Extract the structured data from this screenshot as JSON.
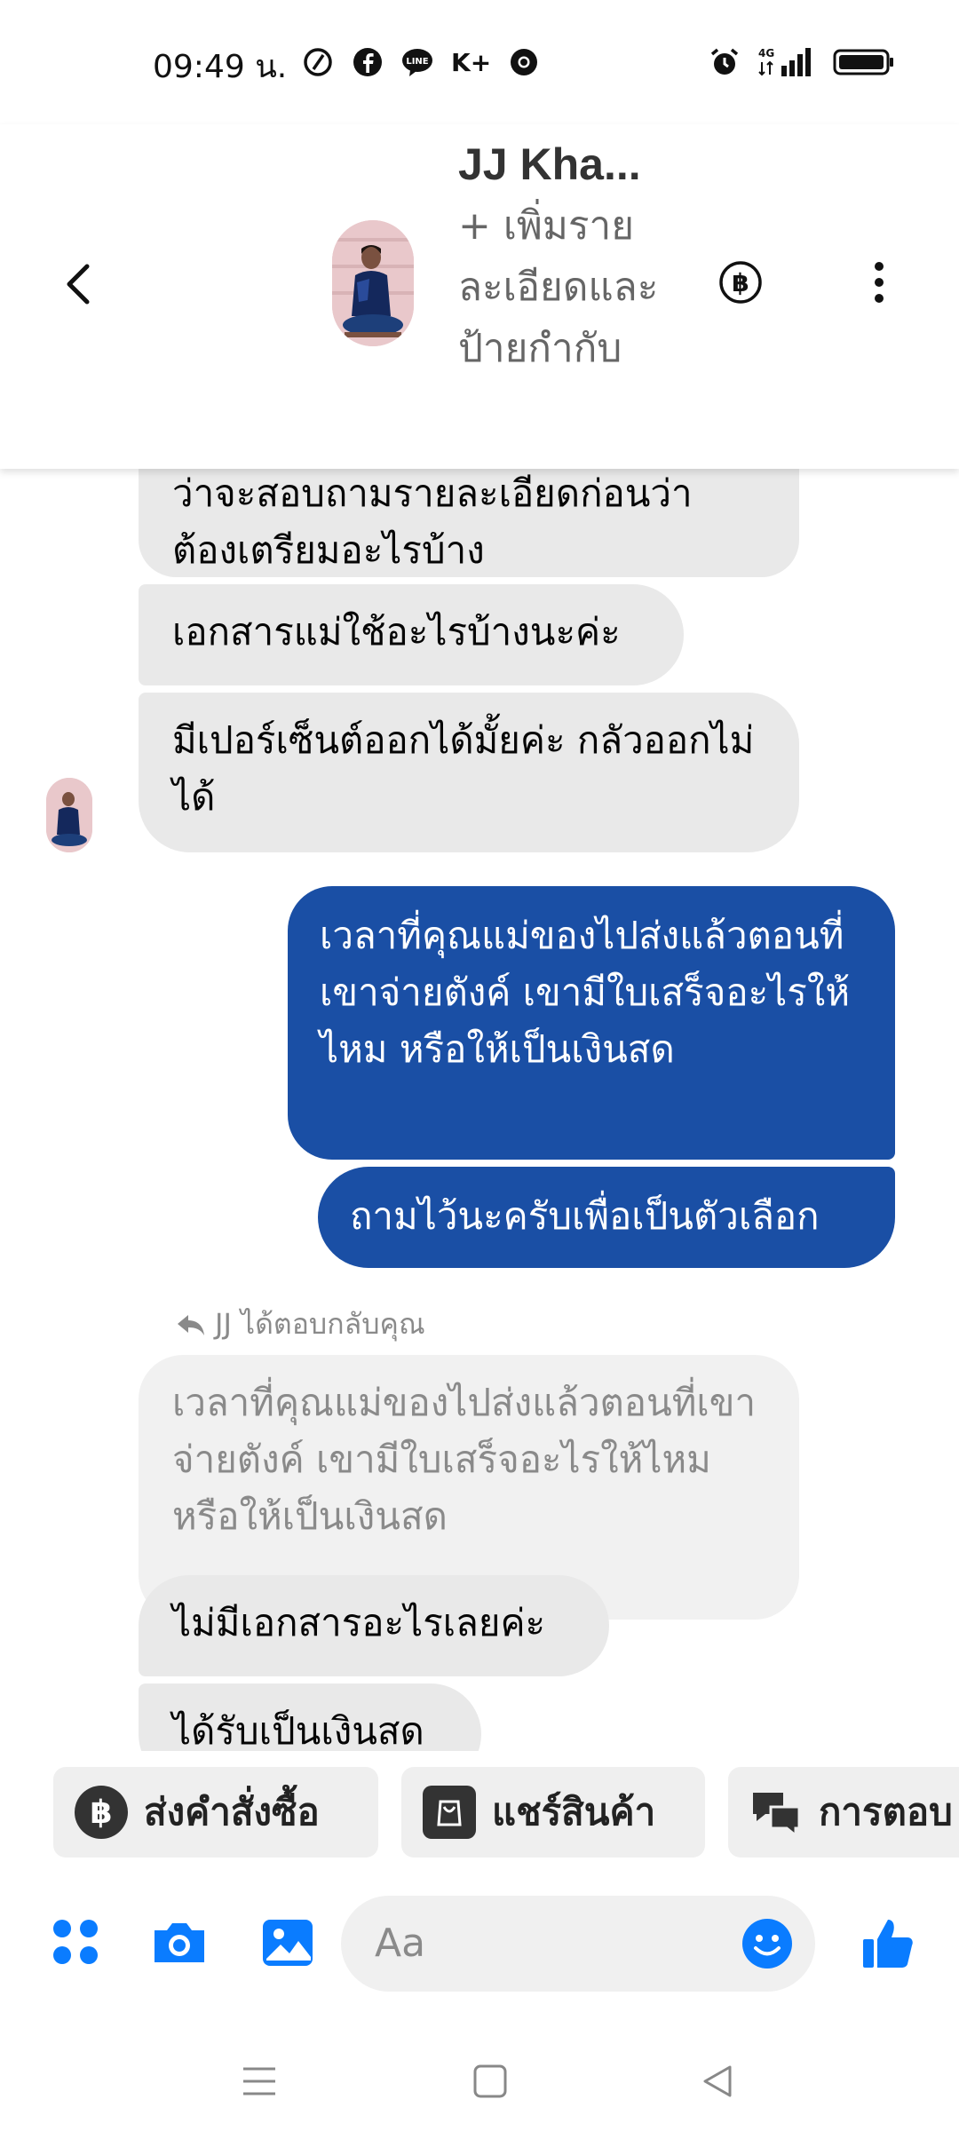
{
  "status_bar": {
    "time": "09:49 น.",
    "network": "4G"
  },
  "header": {
    "contact_name": "JJ Kha...",
    "add_details": "+ เพิ่มรายละเอียดและป้ายกำกับ"
  },
  "messages": [
    {
      "side": "incoming",
      "text": "ว่าจะสอบถามรายละเอียดก่อนว่า ต้องเตรียมอะไรบ้าง"
    },
    {
      "side": "incoming",
      "text": "เอกสารแม่ใช้อะไรบ้างนะค่ะ"
    },
    {
      "side": "incoming",
      "text": "มีเปอร์เซ็นต์ออกได้มั้ยค่ะ กลัวออกไม่ได้"
    },
    {
      "side": "outgoing",
      "text": "เวลาที่คุณแม่ของไปส่งแล้วตอนที่เขาจ่ายตังค์ เขามีใบเสร็จอะไรให้ไหม หรือให้เป็นเงินสด"
    },
    {
      "side": "outgoing",
      "text": "ถามไว้นะครับเพื่อเป็นตัวเลือก"
    },
    {
      "side": "incoming",
      "text": "ไม่มีเอกสารอะไรเลยค่ะ"
    },
    {
      "side": "incoming",
      "text": "ได้รับเป็นเงินสด"
    }
  ],
  "reply": {
    "label": "JJ ได้ตอบกลับคุณ",
    "quoted_text": "เวลาที่คุณแม่ของไปส่งแล้วตอนที่เขาจ่ายตังค์ เขามีใบเสร็จอะไรให้ไหม หรือให้เป็นเงินสด"
  },
  "quick_actions": [
    {
      "label": "ส่งคำสั่งซื้อ",
      "icon": "baht-icon"
    },
    {
      "label": "แชร์สินค้า",
      "icon": "shopping-bag-icon"
    },
    {
      "label": "การตอบ",
      "icon": "chat-bubbles-icon"
    }
  ],
  "composer": {
    "placeholder": "Aa"
  },
  "colors": {
    "messenger_blue": "#0a7cff",
    "outgoing_bubble": "#1a4fa5",
    "incoming_bubble": "#e9e9e9"
  }
}
